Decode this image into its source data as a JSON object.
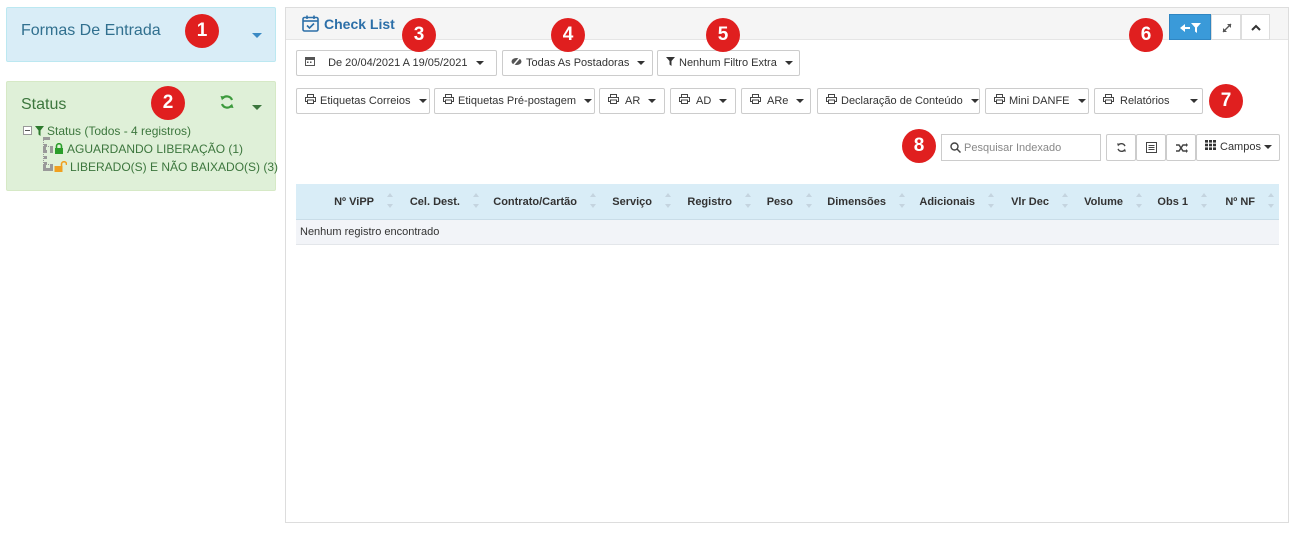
{
  "formas": {
    "title": "Formas De Entrada"
  },
  "status": {
    "title": "Status",
    "tree": {
      "root": "Status (Todos - 4 registros)",
      "items": [
        {
          "label": "AGUARDANDO LIBERAÇÃO (1)",
          "icon": "lock-icon",
          "color": "#2a9d2a"
        },
        {
          "label": "LIBERADO(S) E NÃO BAIXADO(S) (3)",
          "icon": "unlock-icon",
          "color": "#f0a020"
        }
      ]
    }
  },
  "main": {
    "title": "Check List",
    "filters": {
      "date_range": "De 20/04/2021 A 19/05/2021",
      "postadoras": "Todas As Postadoras",
      "extra": "Nenhum Filtro Extra"
    },
    "print_buttons": [
      "Etiquetas Correios",
      "Etiquetas Pré-postagem",
      "AR",
      "AD",
      "ARe",
      "Declaração de Conteúdo",
      "Mini DANFE",
      "Relatórios"
    ],
    "search": {
      "placeholder": "Pesquisar Indexado",
      "value": ""
    },
    "fields_button": "Campos",
    "columns": [
      "Nº ViPP",
      "Cel. Dest.",
      "Contrato/Cartão",
      "Serviço",
      "Registro",
      "Peso",
      "Dimensões",
      "Adicionais",
      "Vlr Dec",
      "Volume",
      "Obs 1",
      "Nº NF"
    ],
    "empty_message": "Nenhum registro encontrado"
  },
  "badges": [
    "1",
    "2",
    "3",
    "4",
    "5",
    "6",
    "7",
    "8"
  ],
  "colors": {
    "info_bg": "#d9edf7",
    "success_bg": "#dff0d8",
    "primary": "#3a9ad9",
    "badge": "#e01f1f"
  }
}
